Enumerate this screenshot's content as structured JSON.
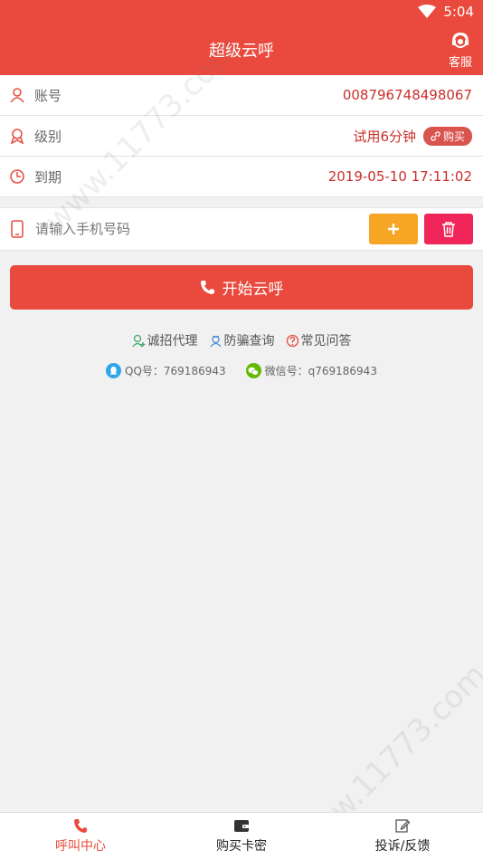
{
  "status": {
    "time": "5:04"
  },
  "header": {
    "title": "超级云呼",
    "service_label": "客服"
  },
  "info": {
    "account_label": "账号",
    "account_value": "008796748498067",
    "level_label": "级别",
    "level_value": "试用6分钟",
    "buy_label": "购买",
    "expire_label": "到期",
    "expire_value": "2019-05-10 17:11:02"
  },
  "phone": {
    "placeholder": "请输入手机号码",
    "add_symbol": "+"
  },
  "start_button": "开始云呼",
  "links": {
    "agent": "诚招代理",
    "anti_fraud": "防骗查询",
    "faq": "常见问答"
  },
  "contacts": {
    "qq": "QQ号：769186943",
    "wechat": "微信号：q769186943"
  },
  "tabs": {
    "call_center": "呼叫中心",
    "buy_card": "购买卡密",
    "complaint": "投诉/反馈"
  },
  "watermark": "www.11773.com",
  "colors": {
    "brand": "#e94a3d",
    "add": "#f6a524",
    "delete": "#f0265a",
    "value": "#c9302c"
  }
}
